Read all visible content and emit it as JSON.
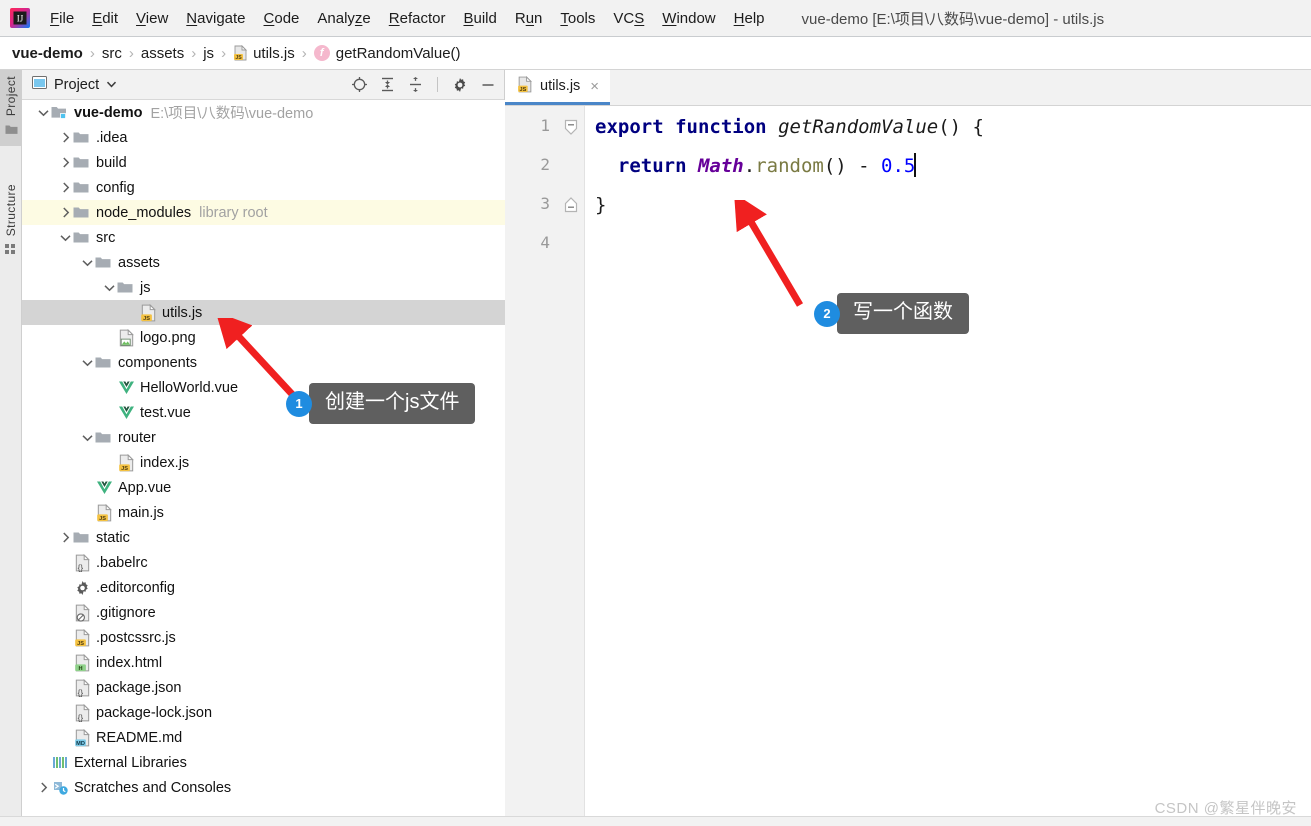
{
  "window": {
    "title": "vue-demo [E:\\项目\\八数码\\vue-demo] - utils.js",
    "logo_icon": "intellij-idea-logo"
  },
  "menu": {
    "items": [
      {
        "label": "File",
        "mnemonic": "F"
      },
      {
        "label": "Edit",
        "mnemonic": "E"
      },
      {
        "label": "View",
        "mnemonic": "V"
      },
      {
        "label": "Navigate",
        "mnemonic": "N"
      },
      {
        "label": "Code",
        "mnemonic": "C"
      },
      {
        "label": "Analyze",
        "mnemonic": "z"
      },
      {
        "label": "Refactor",
        "mnemonic": "R"
      },
      {
        "label": "Build",
        "mnemonic": "B"
      },
      {
        "label": "Run",
        "mnemonic": "u"
      },
      {
        "label": "Tools",
        "mnemonic": "T"
      },
      {
        "label": "VCS",
        "mnemonic": "S"
      },
      {
        "label": "Window",
        "mnemonic": "W"
      },
      {
        "label": "Help",
        "mnemonic": "H"
      }
    ]
  },
  "breadcrumb": {
    "separator": "›",
    "items": [
      {
        "label": "vue-demo",
        "icon": "none",
        "bold": true
      },
      {
        "label": "src",
        "icon": "none",
        "bold": false
      },
      {
        "label": "assets",
        "icon": "none",
        "bold": false
      },
      {
        "label": "js",
        "icon": "none",
        "bold": false
      },
      {
        "label": "utils.js",
        "icon": "js-file-icon",
        "bold": false
      },
      {
        "label": "getRandomValue()",
        "icon": "function-icon",
        "bold": false
      }
    ],
    "function_badge": "f"
  },
  "left_rail": {
    "tabs": [
      {
        "label": "Project",
        "icon": "project-folder-icon",
        "active": true
      },
      {
        "label": "Structure",
        "icon": "structure-icon",
        "active": false
      }
    ]
  },
  "project_panel": {
    "header": {
      "title": "Project",
      "view_icon": "project-view-icon",
      "dropdown_icon": "chevron-down-icon",
      "tools": [
        {
          "name": "select-opened-file-icon",
          "tooltip": "Select Opened File"
        },
        {
          "name": "expand-all-icon",
          "tooltip": "Expand All"
        },
        {
          "name": "collapse-all-icon",
          "tooltip": "Collapse All"
        },
        {
          "name": "settings-gear-icon",
          "tooltip": "Settings"
        },
        {
          "name": "hide-icon",
          "tooltip": "Hide"
        }
      ]
    },
    "tree": [
      {
        "label": "vue-demo",
        "note": "E:\\项目\\八数码\\vue-demo",
        "icon": "module-folder-icon",
        "depth": 0,
        "arrow": "expanded",
        "bold": true,
        "state": "normal"
      },
      {
        "label": ".idea",
        "note": "",
        "icon": "folder-icon",
        "depth": 1,
        "arrow": "collapsed",
        "bold": false,
        "state": "normal"
      },
      {
        "label": "build",
        "note": "",
        "icon": "folder-icon",
        "depth": 1,
        "arrow": "collapsed",
        "bold": false,
        "state": "normal"
      },
      {
        "label": "config",
        "note": "",
        "icon": "folder-icon",
        "depth": 1,
        "arrow": "collapsed",
        "bold": false,
        "state": "normal"
      },
      {
        "label": "node_modules",
        "note": "library root",
        "icon": "folder-icon",
        "depth": 1,
        "arrow": "collapsed",
        "bold": false,
        "state": "libroot"
      },
      {
        "label": "src",
        "note": "",
        "icon": "folder-icon",
        "depth": 1,
        "arrow": "expanded",
        "bold": false,
        "state": "normal"
      },
      {
        "label": "assets",
        "note": "",
        "icon": "folder-icon",
        "depth": 2,
        "arrow": "expanded",
        "bold": false,
        "state": "normal"
      },
      {
        "label": "js",
        "note": "",
        "icon": "folder-icon",
        "depth": 3,
        "arrow": "expanded",
        "bold": false,
        "state": "normal"
      },
      {
        "label": "utils.js",
        "note": "",
        "icon": "js-file-icon",
        "depth": 4,
        "arrow": "none",
        "bold": false,
        "state": "selected"
      },
      {
        "label": "logo.png",
        "note": "",
        "icon": "image-file-icon",
        "depth": 3,
        "arrow": "none",
        "bold": false,
        "state": "normal"
      },
      {
        "label": "components",
        "note": "",
        "icon": "folder-icon",
        "depth": 2,
        "arrow": "expanded",
        "bold": false,
        "state": "normal"
      },
      {
        "label": "HelloWorld.vue",
        "note": "",
        "icon": "vue-file-icon",
        "depth": 3,
        "arrow": "none",
        "bold": false,
        "state": "normal"
      },
      {
        "label": "test.vue",
        "note": "",
        "icon": "vue-file-icon",
        "depth": 3,
        "arrow": "none",
        "bold": false,
        "state": "normal"
      },
      {
        "label": "router",
        "note": "",
        "icon": "folder-icon",
        "depth": 2,
        "arrow": "expanded",
        "bold": false,
        "state": "normal"
      },
      {
        "label": "index.js",
        "note": "",
        "icon": "js-file-icon",
        "depth": 3,
        "arrow": "none",
        "bold": false,
        "state": "normal"
      },
      {
        "label": "App.vue",
        "note": "",
        "icon": "vue-file-icon",
        "depth": 2,
        "arrow": "none",
        "bold": false,
        "state": "normal"
      },
      {
        "label": "main.js",
        "note": "",
        "icon": "js-file-icon",
        "depth": 2,
        "arrow": "none",
        "bold": false,
        "state": "normal"
      },
      {
        "label": "static",
        "note": "",
        "icon": "folder-icon",
        "depth": 1,
        "arrow": "collapsed",
        "bold": false,
        "state": "normal"
      },
      {
        "label": ".babelrc",
        "note": "",
        "icon": "json-file-icon",
        "depth": 1,
        "arrow": "none",
        "bold": false,
        "state": "normal"
      },
      {
        "label": ".editorconfig",
        "note": "",
        "icon": "config-file-icon",
        "depth": 1,
        "arrow": "none",
        "bold": false,
        "state": "normal"
      },
      {
        "label": ".gitignore",
        "note": "",
        "icon": "gitignore-file-icon",
        "depth": 1,
        "arrow": "none",
        "bold": false,
        "state": "normal"
      },
      {
        "label": ".postcssrc.js",
        "note": "",
        "icon": "js-file-icon",
        "depth": 1,
        "arrow": "none",
        "bold": false,
        "state": "normal"
      },
      {
        "label": "index.html",
        "note": "",
        "icon": "html-file-icon",
        "depth": 1,
        "arrow": "none",
        "bold": false,
        "state": "normal"
      },
      {
        "label": "package.json",
        "note": "",
        "icon": "json-file-icon",
        "depth": 1,
        "arrow": "none",
        "bold": false,
        "state": "normal"
      },
      {
        "label": "package-lock.json",
        "note": "",
        "icon": "json-file-icon",
        "depth": 1,
        "arrow": "none",
        "bold": false,
        "state": "normal"
      },
      {
        "label": "README.md",
        "note": "",
        "icon": "markdown-file-icon",
        "depth": 1,
        "arrow": "none",
        "bold": false,
        "state": "normal"
      },
      {
        "label": "External Libraries",
        "note": "",
        "icon": "external-libraries-icon",
        "depth": 0,
        "arrow": "none",
        "bold": false,
        "state": "normal"
      },
      {
        "label": "Scratches and Consoles",
        "note": "",
        "icon": "scratches-icon",
        "depth": 0,
        "arrow": "collapsed",
        "bold": false,
        "state": "normal"
      }
    ]
  },
  "editor": {
    "tabs": [
      {
        "label": "utils.js",
        "icon": "js-file-icon",
        "close_icon": "×",
        "active": true
      }
    ],
    "line_numbers": [
      "1",
      "2",
      "3",
      "4"
    ],
    "highlighted_line": 2,
    "lines": [
      {
        "n": 1,
        "tokens": [
          {
            "t": "export",
            "c": "kw"
          },
          {
            "t": " ",
            "c": "pun"
          },
          {
            "t": "function",
            "c": "kw"
          },
          {
            "t": " ",
            "c": "pun"
          },
          {
            "t": "getRandomValue",
            "c": "fnn"
          },
          {
            "t": "() {",
            "c": "pun"
          }
        ]
      },
      {
        "n": 2,
        "tokens": [
          {
            "t": "  ",
            "c": "pun"
          },
          {
            "t": "return",
            "c": "kw"
          },
          {
            "t": " ",
            "c": "pun"
          },
          {
            "t": "Math",
            "c": "cls"
          },
          {
            "t": ".",
            "c": "pun"
          },
          {
            "t": "random",
            "c": "mtd"
          },
          {
            "t": "() - ",
            "c": "pun"
          },
          {
            "t": "0.5",
            "c": "num"
          }
        ]
      },
      {
        "n": 3,
        "tokens": [
          {
            "t": "}",
            "c": "pun"
          }
        ]
      },
      {
        "n": 4,
        "tokens": []
      }
    ],
    "plain_text": "export function getRandomValue() {\n  return Math.random() - 0.5\n}\n",
    "fold_markers": [
      {
        "line": 1,
        "type": "fold-start-icon"
      },
      {
        "line": 3,
        "type": "fold-end-icon"
      }
    ]
  },
  "annotations": [
    {
      "number": "1",
      "text": "创建一个js文件",
      "arrow_from": "utils.js tree node"
    },
    {
      "number": "2",
      "text": "写一个函数",
      "arrow_from": "editor line 2"
    }
  ],
  "watermark": "CSDN @繁星伴晚安",
  "colors": {
    "accent_blue": "#1f8ce0",
    "tab_underline": "#4a86c8",
    "callout_bg": "#5f5f5f",
    "arrow_red": "#f02020",
    "library_root_row": "#fdfbe3",
    "selected_row": "#d4d4d4",
    "current_line": "#fdf8e3",
    "keyword": "#000080",
    "number": "#0000ff",
    "class_name": "#660099",
    "method_name": "#7a7a43",
    "panel_bg": "#f2f2f2"
  }
}
